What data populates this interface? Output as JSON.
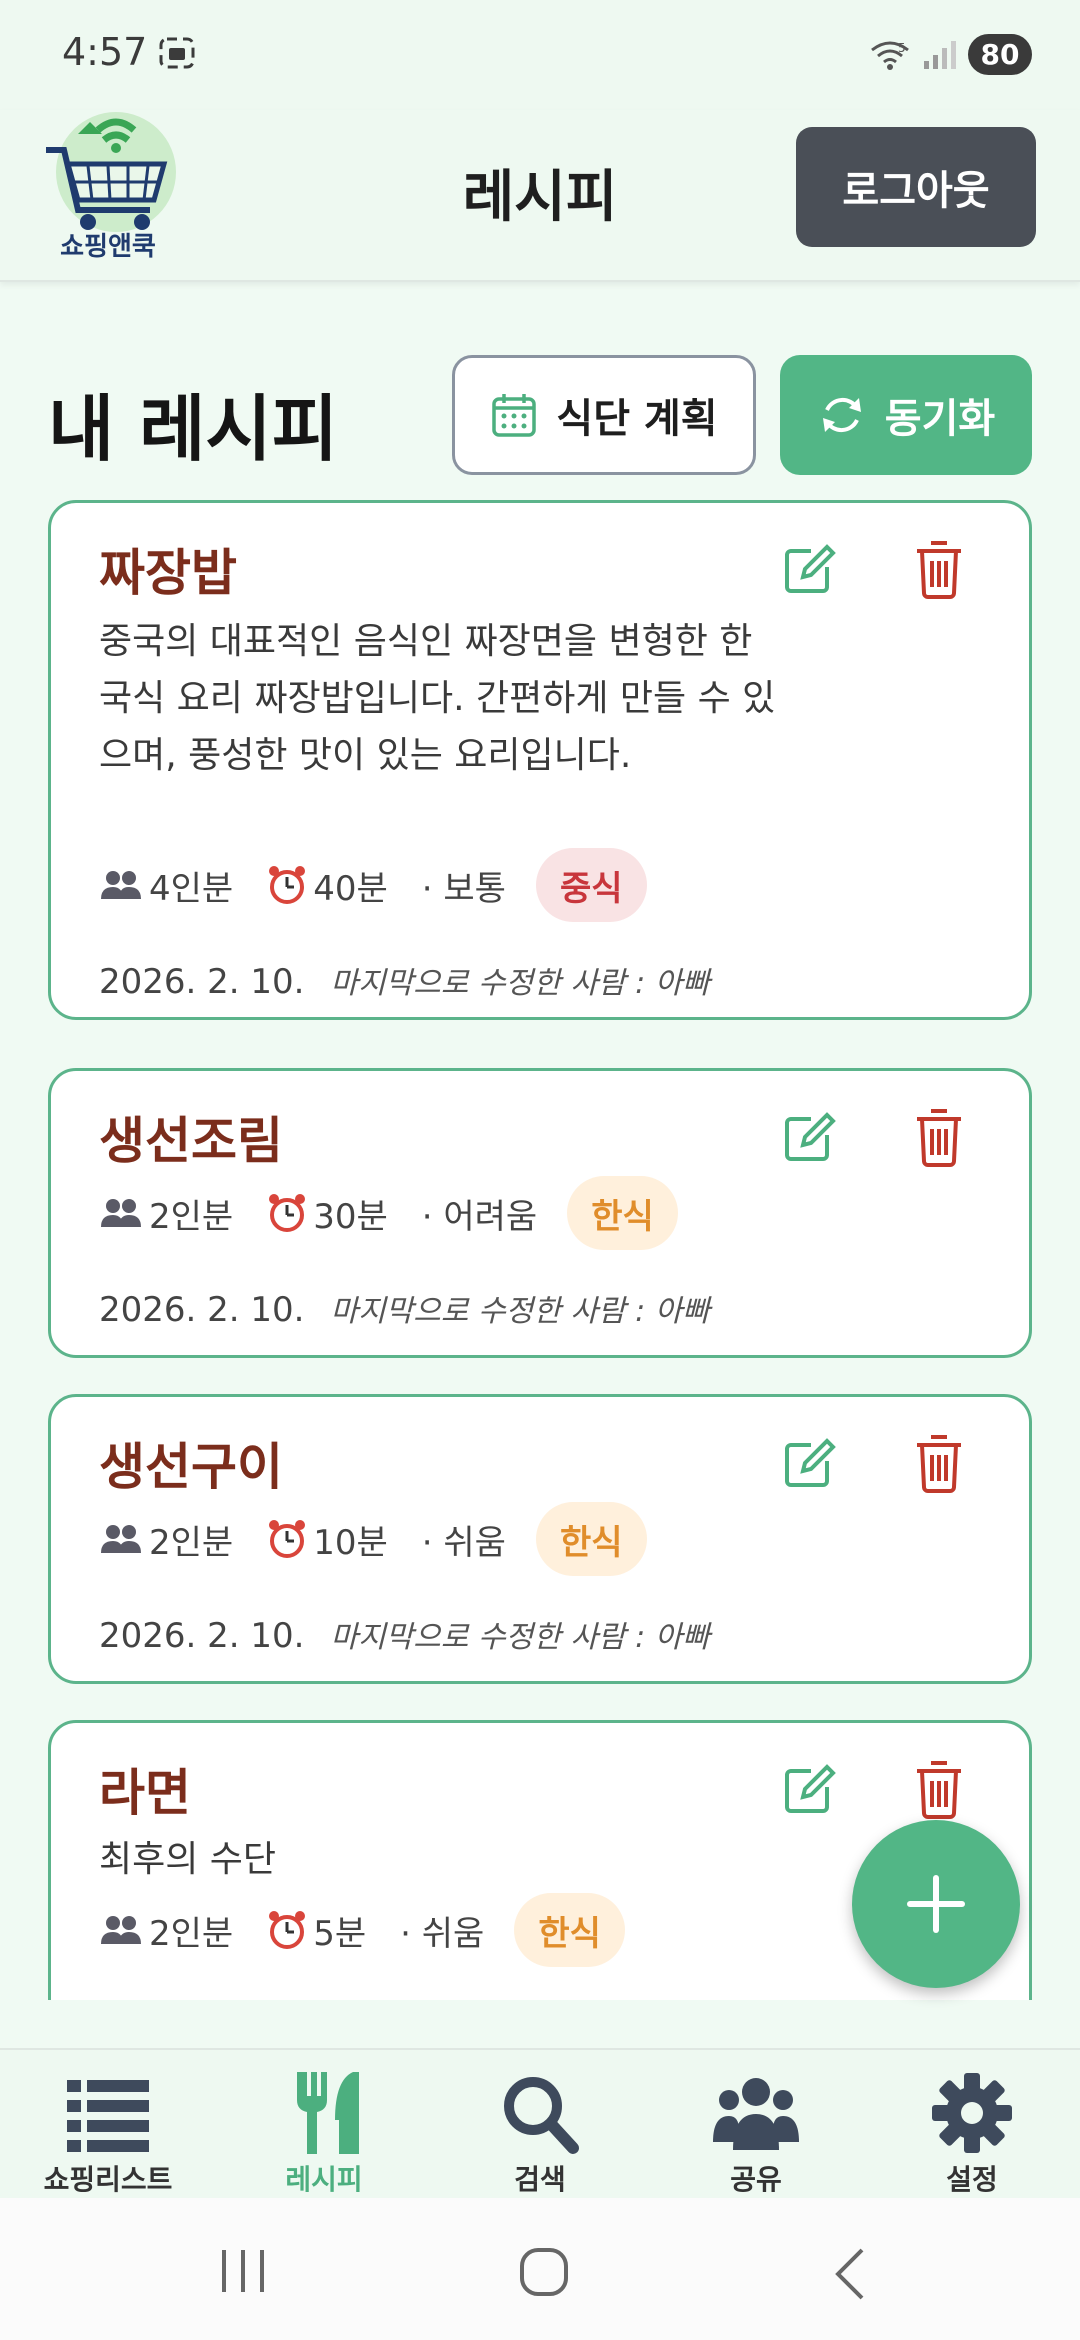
{
  "status_bar": {
    "time": "4:57",
    "battery": "80",
    "network": "5"
  },
  "header": {
    "logo_text": "쇼핑앤쿡",
    "title": "레시피",
    "logout_label": "로그아웃"
  },
  "section": {
    "title": "내 레시피",
    "meal_plan_label": "식단 계획",
    "sync_label": "동기화"
  },
  "recipes": [
    {
      "name": "짜장밥",
      "description": "중국의 대표적인 음식인 짜장면을 변형한 한국식 요리 짜장밥입니다. 간편하게 만들 수 있으며, 풍성한 맛이 있는 요리입니다.",
      "servings": "4인분",
      "time": "40분",
      "difficulty": "· 보통",
      "category": "중식",
      "category_color": "red",
      "date": "2026. 2. 10.",
      "editor": "마지막으로 수정한 사람 : 아빠"
    },
    {
      "name": "생선조림",
      "description": "",
      "servings": "2인분",
      "time": "30분",
      "difficulty": "· 어려움",
      "category": "한식",
      "category_color": "orange",
      "date": "2026. 2. 10.",
      "editor": "마지막으로 수정한 사람 : 아빠"
    },
    {
      "name": "생선구이",
      "description": "",
      "servings": "2인분",
      "time": "10분",
      "difficulty": "· 쉬움",
      "category": "한식",
      "category_color": "orange",
      "date": "2026. 2. 10.",
      "editor": "마지막으로 수정한 사람 : 아빠"
    },
    {
      "name": "라면",
      "description": "최후의 수단",
      "servings": "2인분",
      "time": "5분",
      "difficulty": "· 쉬움",
      "category": "한식",
      "category_color": "orange",
      "date": "",
      "editor": ""
    }
  ],
  "bottom_nav": [
    {
      "label": "쇼핑리스트",
      "icon": "list-icon",
      "active": false
    },
    {
      "label": "레시피",
      "icon": "fork-knife-icon",
      "active": true
    },
    {
      "label": "검색",
      "icon": "search-icon",
      "active": false
    },
    {
      "label": "공유",
      "icon": "users-icon",
      "active": false
    },
    {
      "label": "설정",
      "icon": "gear-icon",
      "active": false
    }
  ],
  "colors": {
    "accent": "#52b686",
    "logout": "#4a4f57",
    "recipe_name": "#7b2d1c",
    "delete": "#c0392b"
  }
}
